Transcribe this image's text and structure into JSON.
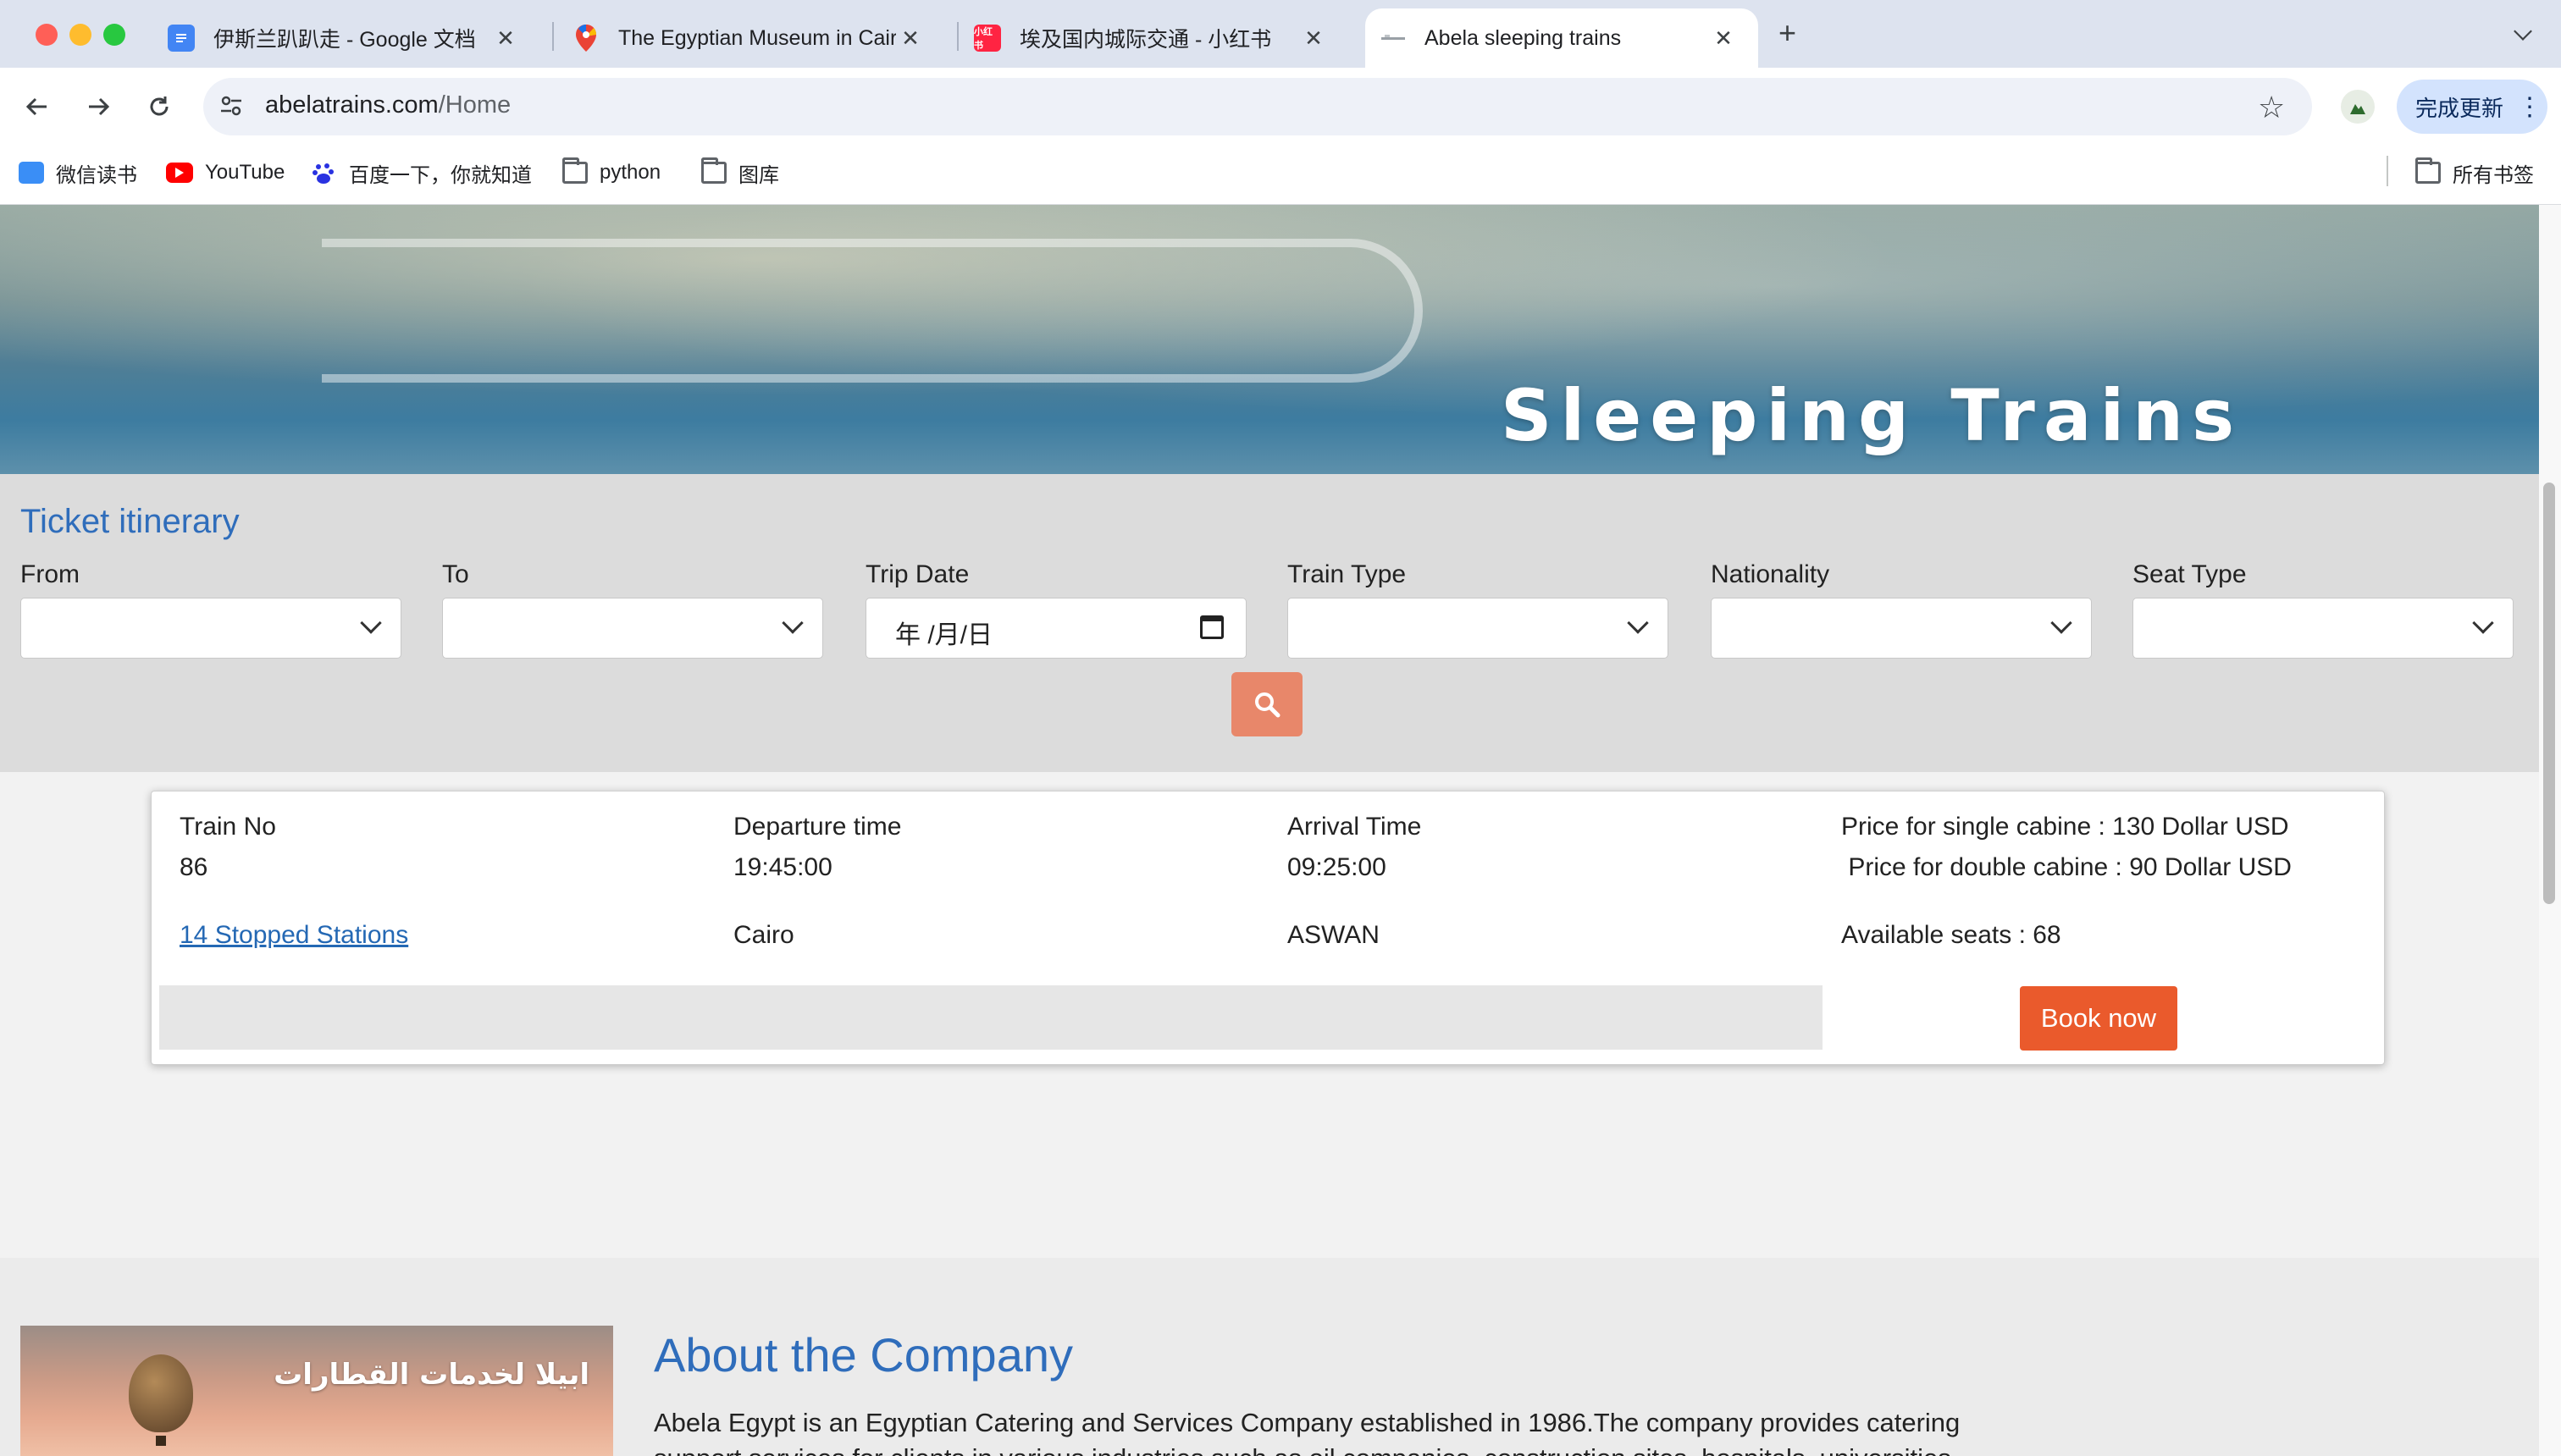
{
  "browser": {
    "tabs": [
      {
        "title": "伊斯兰趴趴走 - Google 文档",
        "icon": "google-docs-icon"
      },
      {
        "title": "The Egyptian Museum in Cairo",
        "icon": "google-maps-icon"
      },
      {
        "title": "埃及国内城际交通 - 小红书",
        "icon": "xiaohongshu-icon"
      },
      {
        "title": "Abela sleeping trains",
        "icon": "abela-favicon",
        "active": true
      }
    ],
    "url_host": "abelatrains.com",
    "url_path": "/Home",
    "update_label": "完成更新",
    "bookmarks": [
      {
        "label": "微信读书",
        "icon": "weread-icon"
      },
      {
        "label": "YouTube",
        "icon": "youtube-icon"
      },
      {
        "label": "百度一下，你就知道",
        "icon": "baidu-icon"
      },
      {
        "label": "python",
        "icon": "folder-icon"
      },
      {
        "label": "图库",
        "icon": "folder-icon"
      }
    ],
    "all_bookmarks_label": "所有书签"
  },
  "hero": {
    "title": "Sleeping Trains"
  },
  "itinerary": {
    "title": "Ticket itinerary",
    "fields": {
      "from": {
        "label": "From",
        "value": ""
      },
      "to": {
        "label": "To",
        "value": ""
      },
      "trip_date": {
        "label": "Trip Date",
        "value": "年 /月/日"
      },
      "train_type": {
        "label": "Train Type",
        "value": ""
      },
      "nationality": {
        "label": "Nationality",
        "value": ""
      },
      "seat_type": {
        "label": "Seat Type",
        "value": ""
      }
    }
  },
  "result": {
    "train_no_label": "Train No",
    "train_no": "86",
    "departure_label": "Departure time",
    "departure_time": "19:45:00",
    "arrival_label": "Arrival Time",
    "arrival_time": "09:25:00",
    "price_single": "Price for single cabine : 130 Dollar USD",
    "price_double": " Price for double cabine : 90 Dollar USD",
    "stations_link": "14 Stopped Stations",
    "from_city": "Cairo",
    "to_city": "ASWAN",
    "available_seats": "Available seats : 68",
    "book_label": "Book now"
  },
  "about": {
    "image_text": "ابيلا لخدمات القطارات",
    "title": "About the Company",
    "text": "Abela Egypt is an Egyptian Catering and Services Company established in 1986.The company provides catering support services for clients in various industries such as oil companies, construction sites, hospitals, universities, schools and"
  },
  "colors": {
    "accent_blue": "#2f6dbb",
    "book_button": "#ea5a2c",
    "search_button": "#e8876a",
    "link": "#2468b4"
  }
}
